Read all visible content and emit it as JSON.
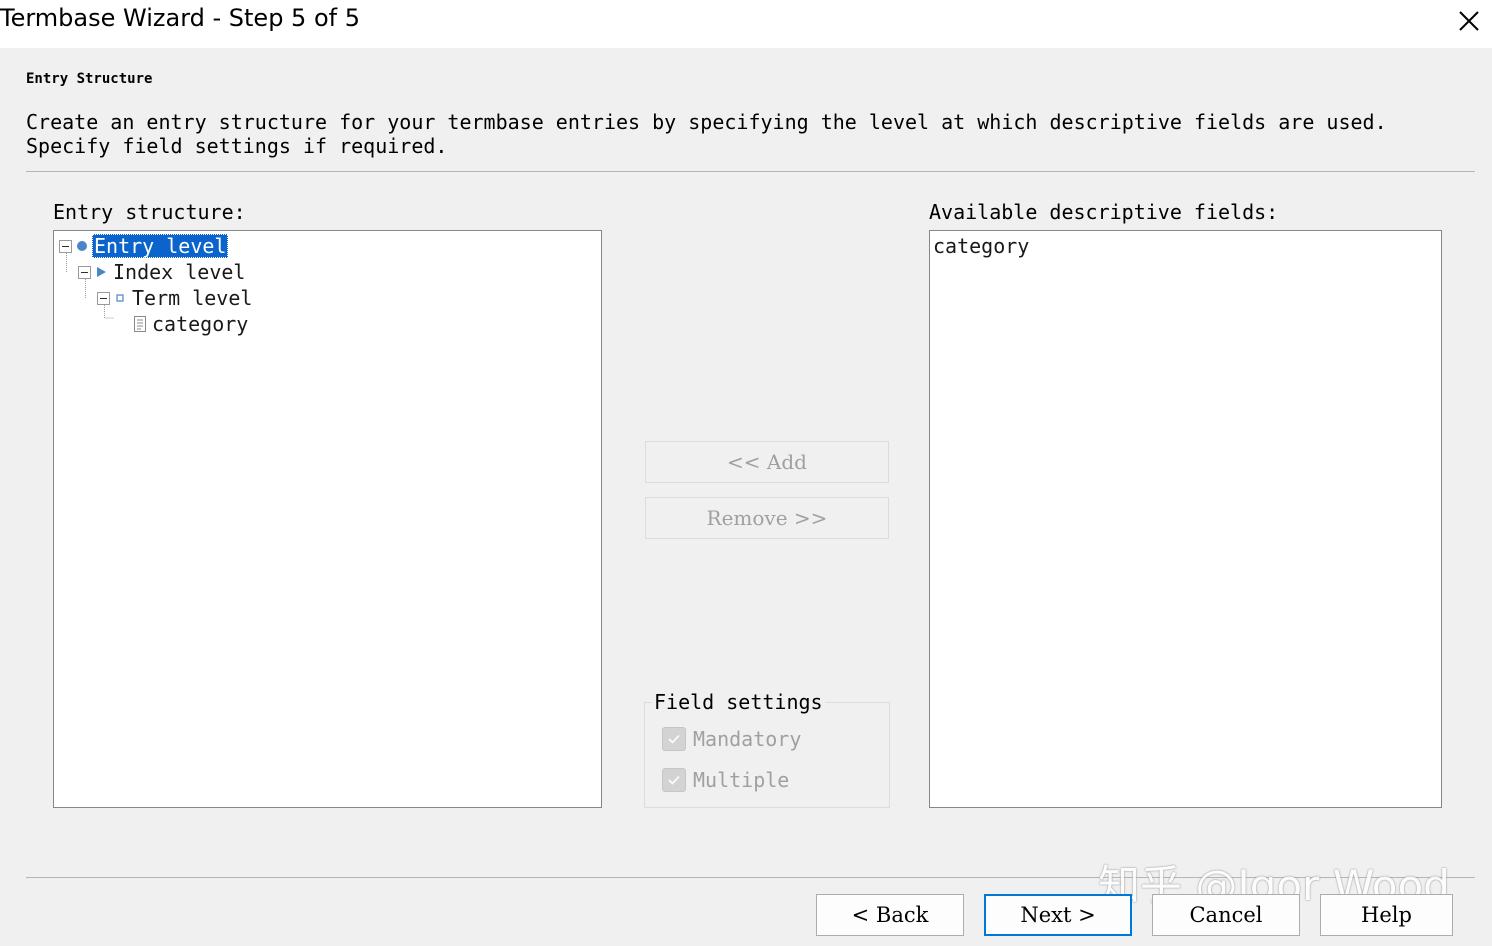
{
  "window": {
    "title": "Termbase Wizard - Step 5 of 5"
  },
  "header": {
    "title": "Entry Structure",
    "description_lines": [
      "Create an entry structure for your termbase entries by specifying the level at which descriptive fields are used.",
      "Specify field settings if required."
    ]
  },
  "entry_structure": {
    "label": "Entry structure:",
    "tree": [
      {
        "label": "Entry level",
        "selected": true,
        "icon": "circle-icon"
      },
      {
        "label": "Index level",
        "icon": "triangle-icon"
      },
      {
        "label": "Term level",
        "icon": "square-icon"
      },
      {
        "label": "category",
        "icon": "field-document-icon"
      }
    ]
  },
  "available_fields": {
    "label": "Available descriptive fields:",
    "items": [
      "category"
    ]
  },
  "buttons_mid": {
    "add": "<< Add",
    "remove": "Remove >>"
  },
  "field_settings": {
    "legend": "Field settings",
    "mandatory": {
      "label": "Mandatory",
      "checked": true,
      "disabled": true
    },
    "multiple": {
      "label": "Multiple",
      "checked": true,
      "disabled": true
    }
  },
  "footer": {
    "back": "< Back",
    "next": "Next >",
    "cancel": "Cancel",
    "help": "Help"
  },
  "watermark": "知乎 @Igor Wood",
  "colors": {
    "selection": "#0a64cc",
    "node_icon": "#4a86c5",
    "default_button_border": "#0078d7"
  }
}
